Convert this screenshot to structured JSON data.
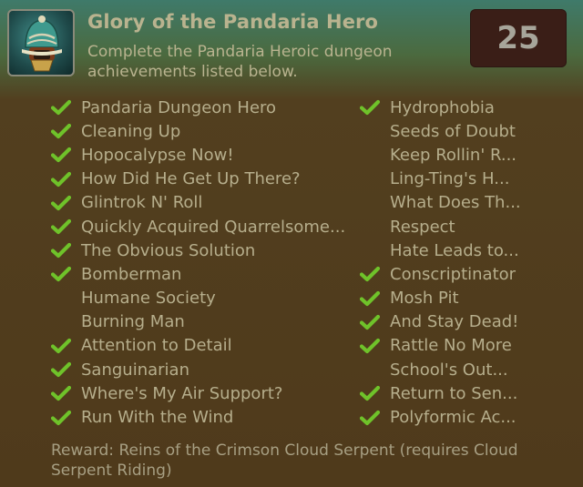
{
  "achievement": {
    "title": "Glory of the Pandaria Hero",
    "description": "Complete the Pandaria Heroic dungeon achievements listed below.",
    "points": "25",
    "icon": "pandaren-helm-icon",
    "reward": "Reward: Reins of the Crimson Cloud Serpent (requires Cloud Serpent Riding)"
  },
  "criteria_left": [
    {
      "label": "Pandaria Dungeon Hero",
      "completed": true
    },
    {
      "label": "Cleaning Up",
      "completed": true
    },
    {
      "label": "Hopocalypse Now!",
      "completed": true
    },
    {
      "label": "How Did He Get Up There?",
      "completed": true
    },
    {
      "label": "Glintrok N' Roll",
      "completed": true
    },
    {
      "label": "Quickly Acquired Quarrelsome...",
      "completed": true
    },
    {
      "label": "The Obvious Solution",
      "completed": true
    },
    {
      "label": "Bomberman",
      "completed": true
    },
    {
      "label": "Humane Society",
      "completed": false
    },
    {
      "label": "Burning Man",
      "completed": false
    },
    {
      "label": "Attention to Detail",
      "completed": true
    },
    {
      "label": "Sanguinarian",
      "completed": true
    },
    {
      "label": "Where's My Air Support?",
      "completed": true
    },
    {
      "label": "Run With the Wind",
      "completed": true
    }
  ],
  "criteria_right": [
    {
      "label": "Hydrophobia",
      "completed": true
    },
    {
      "label": "Seeds of Doubt",
      "completed": false
    },
    {
      "label": "Keep Rollin' R...",
      "completed": false
    },
    {
      "label": "Ling-Ting's H...",
      "completed": false
    },
    {
      "label": "What Does Th...",
      "completed": false
    },
    {
      "label": "Respect",
      "completed": false
    },
    {
      "label": "Hate Leads to...",
      "completed": false
    },
    {
      "label": "Conscriptinator",
      "completed": true
    },
    {
      "label": "Mosh Pit",
      "completed": true
    },
    {
      "label": "And Stay Dead!",
      "completed": true
    },
    {
      "label": "Rattle No More",
      "completed": true
    },
    {
      "label": "School's Out...",
      "completed": false
    },
    {
      "label": "Return to Sen...",
      "completed": true
    },
    {
      "label": "Polyformic Ac...",
      "completed": true
    }
  ],
  "colors": {
    "check": "#6fc22a",
    "text": "#b6ae8c",
    "points_bg": "#3a1e17"
  }
}
